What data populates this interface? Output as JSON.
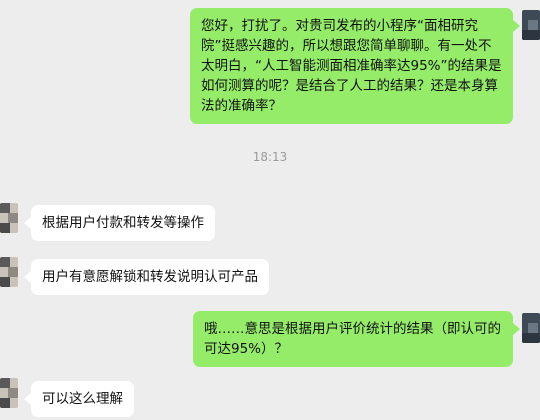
{
  "chat": {
    "messages": [
      {
        "direction": "outgoing",
        "text": "您好，打扰了。对贵司发布的小程序“面相研究院”挺感兴趣的，所以想跟您简单聊聊。有一处不太明白，“人工智能测面相准确率达95%”的结果是如何测算的呢？是结合了人工的结果？还是本身算法的准确率？"
      },
      {
        "direction": "incoming",
        "text": "根据用户付款和转发等操作"
      },
      {
        "direction": "incoming",
        "text": "用户有意愿解锁和转发说明认可产品"
      },
      {
        "direction": "outgoing",
        "text": "哦……意思是根据用户评价统计的结果（即认可的可达95%）？"
      },
      {
        "direction": "incoming",
        "text": "可以这么理解"
      }
    ],
    "timestamp": "18:13"
  },
  "colors": {
    "background": "#ededed",
    "outgoing_bubble": "#95ec69",
    "incoming_bubble": "#ffffff",
    "timestamp_text": "#9a9a9a"
  },
  "icons": [
    "avatar-pixelated"
  ]
}
